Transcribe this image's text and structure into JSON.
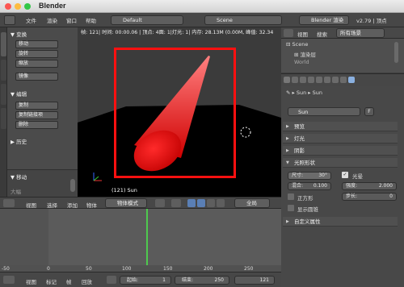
{
  "window": {
    "title": "Blender",
    "close_color": "#fc5753",
    "min_color": "#fdbc40",
    "max_color": "#33c748"
  },
  "topbar": {
    "menus": [
      "文件",
      "渲染",
      "窗口",
      "帮助"
    ],
    "layout_value": "Default",
    "scene_value": "Scene",
    "engine_value": "Blender 渲染",
    "version": "v2.79 | 顶点"
  },
  "toolpanel": {
    "sections": {
      "transform": "变换",
      "edit": "编辑",
      "history": "历史",
      "operator": "移动"
    },
    "transform_buttons": [
      "移动",
      "旋转",
      "缩放",
      "镜像"
    ],
    "edit_buttons": [
      "复制",
      "复制链接项",
      "删除"
    ],
    "operator_label": "大幅"
  },
  "viewport": {
    "info": "帧: 121| 时间: 00:00.06 | 顶点: 4面: 1|灯光: 1| 内存: 28.13M (0.00M, 峰值: 32.34",
    "object_label": "(121) Sun",
    "highlight_color": "#ff1010"
  },
  "viewport_header": {
    "menus": [
      "视图",
      "选择",
      "添加",
      "物体"
    ],
    "mode": "物体模式",
    "pivot": "全局"
  },
  "outliner": {
    "menus": [
      "视图",
      "搜索"
    ],
    "filter": "所有场景",
    "items": [
      "Scene",
      "渲染层",
      "World"
    ]
  },
  "properties": {
    "breadcrumb": [
      "Sun",
      "Sun"
    ],
    "datablock": "Sun",
    "fake_user": "F",
    "panels": [
      "预览",
      "灯光",
      "阴影",
      "光照形状",
      "自定义属性"
    ],
    "size_label": "尺寸:",
    "size_value": "30°",
    "blend_label": "混合:",
    "blend_value": "0.100",
    "halo_label": "光晕",
    "intensity_label": "强度:",
    "intensity_value": "2.000",
    "step_label": "步长:",
    "step_value": "0",
    "square_label": "正方形",
    "show_cone_label": "显示圆锥"
  },
  "timeline": {
    "ticks": [
      "-50",
      "0",
      "50",
      "100",
      "150",
      "200",
      "250"
    ],
    "current_frame_line": 121,
    "playhead_color": "#4ec94e"
  },
  "timeline_footer": {
    "menus": [
      "视图",
      "标记",
      "帧",
      "回放"
    ],
    "start_label": "起始:",
    "start_value": "1",
    "end_label": "结束:",
    "end_value": "250",
    "current_value": "121"
  }
}
